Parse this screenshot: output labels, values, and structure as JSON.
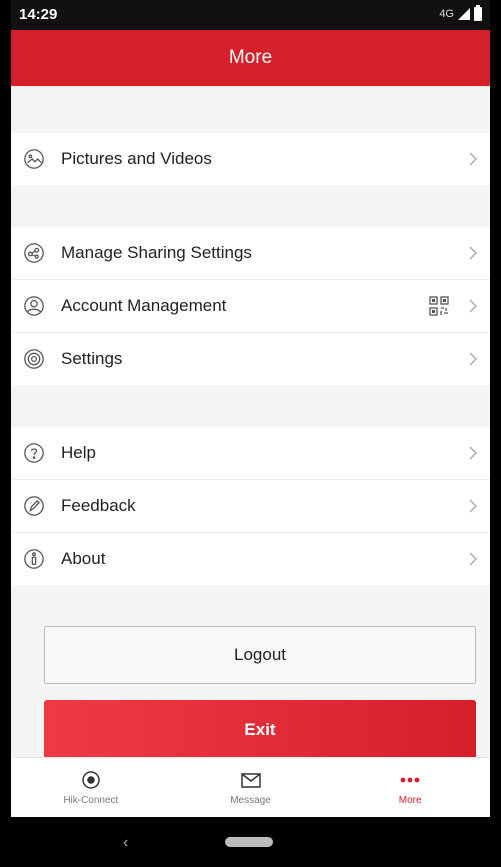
{
  "status": {
    "time": "14:29",
    "network": "4G"
  },
  "header": {
    "title": "More"
  },
  "sections": [
    {
      "items": [
        {
          "label": "Pictures and Videos",
          "icon": "image-icon"
        }
      ]
    },
    {
      "items": [
        {
          "label": "Manage Sharing Settings",
          "icon": "sharing-icon"
        },
        {
          "label": "Account Management",
          "icon": "account-icon",
          "extra_icon": "qr-code-icon"
        },
        {
          "label": "Settings",
          "icon": "settings-icon"
        }
      ]
    },
    {
      "items": [
        {
          "label": "Help",
          "icon": "help-icon"
        },
        {
          "label": "Feedback",
          "icon": "feedback-icon"
        },
        {
          "label": "About",
          "icon": "about-icon"
        }
      ]
    }
  ],
  "buttons": {
    "logout": "Logout",
    "exit": "Exit"
  },
  "tabs": [
    {
      "label": "Hik-Connect",
      "icon": "camera-icon"
    },
    {
      "label": "Message",
      "icon": "message-icon"
    },
    {
      "label": "More",
      "icon": "more-dots-icon"
    }
  ],
  "colors": {
    "accent": "#d71f2b",
    "background": "#f4f4f4"
  },
  "android_nav": {
    "back_icon": "back-chevron-icon",
    "home_icon": "home-pill-icon"
  }
}
